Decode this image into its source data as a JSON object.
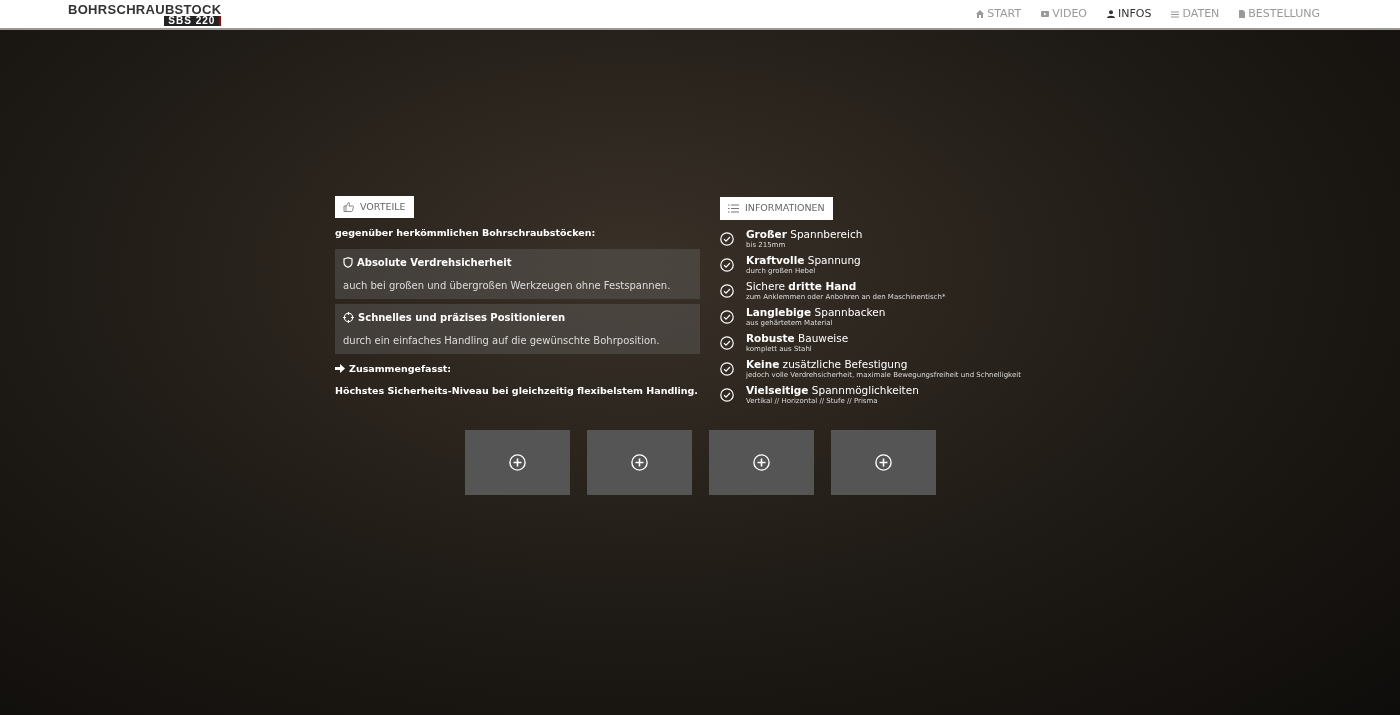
{
  "brand": {
    "title": "BOHRSCHRAUBSTOCK",
    "model": "SBS 220"
  },
  "nav": [
    {
      "label": "START",
      "kind": "home",
      "selected": false
    },
    {
      "label": "VIDEO",
      "kind": "video",
      "selected": false
    },
    {
      "label": "INFOS",
      "kind": "user",
      "selected": true
    },
    {
      "label": "DATEN",
      "kind": "list",
      "selected": false
    },
    {
      "label": "BESTELLUNG",
      "kind": "doc",
      "selected": false
    }
  ],
  "advantages": {
    "badge": "VORTEILE",
    "intro": "gegenüber herkömmlichen Bohrschraubstöcken:",
    "items": [
      {
        "kind": "shield",
        "title": "Absolute Verdrehsicherheit",
        "text": "auch bei großen und übergroßen Werkzeugen ohne Festspannen."
      },
      {
        "kind": "target",
        "title": "Schnelles und präzises Positionieren",
        "text": "durch ein einfaches Handling auf die gewünschte Bohrposition."
      }
    ],
    "summary_label": "Zusammengefasst:",
    "summary": "Höchstes Sicherheits-Niveau bei gleichzeitig flexibelstem Handling."
  },
  "information": {
    "badge": "INFORMATIONEN",
    "items": [
      {
        "title": "**Großer** Spannbereich",
        "text": "bis 215mm"
      },
      {
        "title": "**Kraftvolle** Spannung",
        "text": "durch großen Hebel"
      },
      {
        "title": "Sichere **dritte Hand**",
        "text": "zum Anklemmen oder Anbohren an den Maschinentisch*"
      },
      {
        "title": "**Langlebige** Spannbacken",
        "text": "aus gehärtetem Material"
      },
      {
        "title": "**Robuste** Bauweise",
        "text": "komplett aus Stahl"
      },
      {
        "title": "**Keine** zusätzliche Befestigung",
        "text": "jedoch volle Verdrehsicherheit, maximale Bewegungsfreiheit und Schnelligkeit"
      },
      {
        "title": "**Vielseitige** Spannmöglichkeiten",
        "text": "Vertikal // Horizontal // Stufe // Prisma"
      }
    ]
  },
  "gallery": [
    {
      "kind": "photo"
    },
    {
      "kind": "photo"
    },
    {
      "kind": "photo"
    },
    {
      "kind": "photo"
    }
  ]
}
